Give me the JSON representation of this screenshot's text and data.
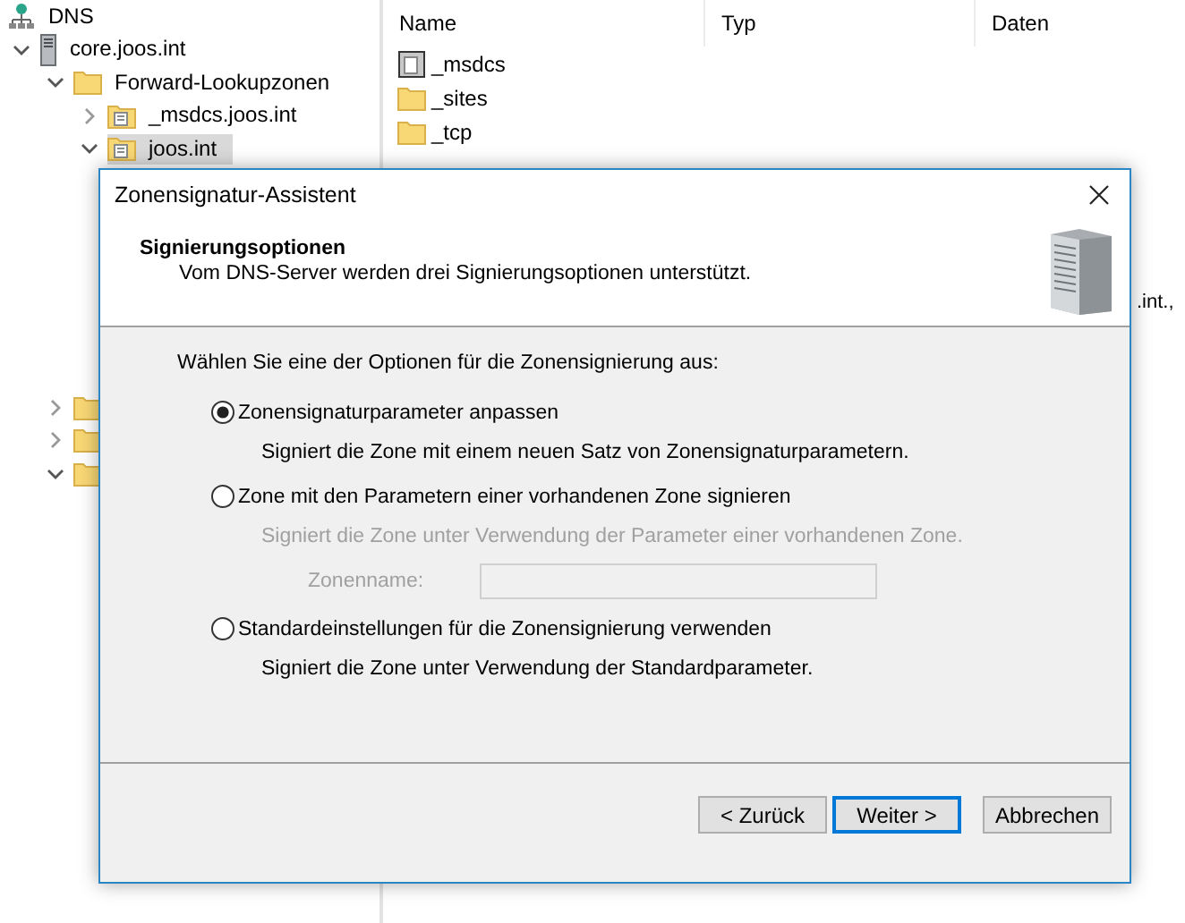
{
  "tree": [
    {
      "label": "DNS",
      "kind": "dns",
      "selected": false,
      "children": [
        {
          "label": "core.joos.int",
          "kind": "server",
          "expanded": true,
          "selected": false,
          "children": [
            {
              "label": "Forward-Lookupzonen",
              "kind": "folder",
              "expanded": true,
              "selected": false,
              "children": [
                {
                  "label": "_msdcs.joos.int",
                  "kind": "zone",
                  "expanded": false,
                  "selected": false
                },
                {
                  "label": "joos.int",
                  "kind": "zone",
                  "expanded": true,
                  "selected": true
                }
              ]
            },
            {
              "kind": "folder",
              "expanded": false,
              "selected": false
            },
            {
              "kind": "folder",
              "expanded": false,
              "selected": false
            },
            {
              "kind": "folder",
              "expanded": true,
              "selected": false
            }
          ]
        }
      ]
    }
  ],
  "list": {
    "columns": [
      "Name",
      "Typ",
      "Daten"
    ],
    "rows": [
      {
        "name": "_msdcs",
        "kind": "delegation"
      },
      {
        "name": "_sites",
        "kind": "folder"
      },
      {
        "name": "_tcp",
        "kind": "folder"
      }
    ],
    "data_fragment": ".int.,"
  },
  "dialog": {
    "title": "Zonensignatur-Assistent",
    "heading": "Signierungsoptionen",
    "subtitle": "Vom DNS-Server werden drei Signierungsoptionen unterstützt.",
    "prompt": "Wählen Sie eine der Optionen für die Zonensignierung aus:",
    "options": [
      {
        "label": "Zonensignaturparameter anpassen",
        "description": "Signiert die Zone mit einem neuen Satz von Zonensignaturparametern.",
        "selected": true,
        "disabled": false
      },
      {
        "label": "Zone mit den Parametern einer vorhandenen Zone signieren",
        "description": "Signiert die Zone unter Verwendung der Parameter einer vorhandenen Zone.",
        "selected": false,
        "disabled": true,
        "field": {
          "label": "Zonenname:",
          "disabled": true
        }
      },
      {
        "label": "Standardeinstellungen für die Zonensignierung verwenden",
        "description": "Signiert die Zone unter Verwendung der Standardparameter.",
        "selected": false,
        "disabled": false
      }
    ],
    "buttons": [
      {
        "label": "< Zurück",
        "default": false
      },
      {
        "label": "Weiter >",
        "default": true
      },
      {
        "label": "Abbrechen",
        "default": false
      }
    ]
  }
}
